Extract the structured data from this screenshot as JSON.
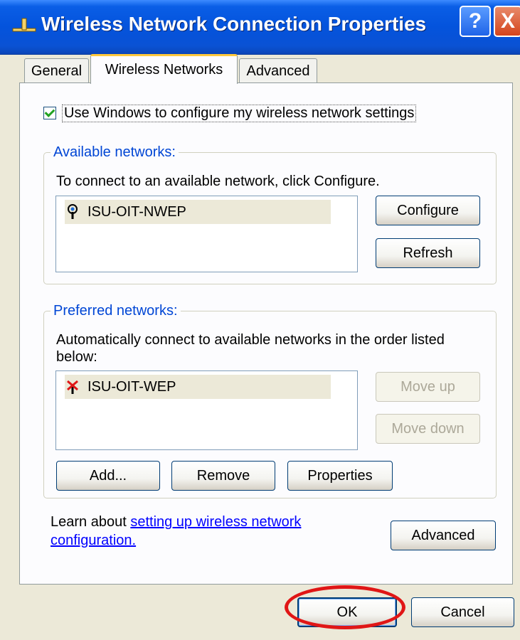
{
  "window": {
    "title": "Wireless Network Connection Properties",
    "help_label": "?",
    "close_label": "X"
  },
  "tabs": [
    {
      "label": "General"
    },
    {
      "label": "Wireless Networks",
      "active": true
    },
    {
      "label": "Advanced"
    }
  ],
  "use_windows_checkbox": {
    "label": "Use Windows to configure my wireless network settings",
    "checked": true
  },
  "available": {
    "legend": "Available networks:",
    "instruction": "To connect to an available network, click Configure.",
    "networks": [
      {
        "name": "ISU-OIT-NWEP",
        "icon": "wireless-network-icon"
      }
    ],
    "configure_label": "Configure",
    "refresh_label": "Refresh"
  },
  "preferred": {
    "legend": "Preferred networks:",
    "instruction_line1": "Automatically connect to available networks in the order listed",
    "instruction_line2": "below:",
    "networks": [
      {
        "name": "ISU-OIT-WEP",
        "icon": "network-disconnected-icon"
      }
    ],
    "move_up_label": "Move up",
    "move_down_label": "Move down",
    "add_label": "Add...",
    "remove_label": "Remove",
    "properties_label": "Properties"
  },
  "learn": {
    "prefix": "Learn about ",
    "link_line1": "setting up wireless network",
    "link_line2": "configuration."
  },
  "advanced_button_label": "Advanced",
  "footer": {
    "ok_label": "OK",
    "cancel_label": "Cancel"
  },
  "colors": {
    "titlebar": "#0453dc",
    "highlight_circle": "#e01616"
  }
}
